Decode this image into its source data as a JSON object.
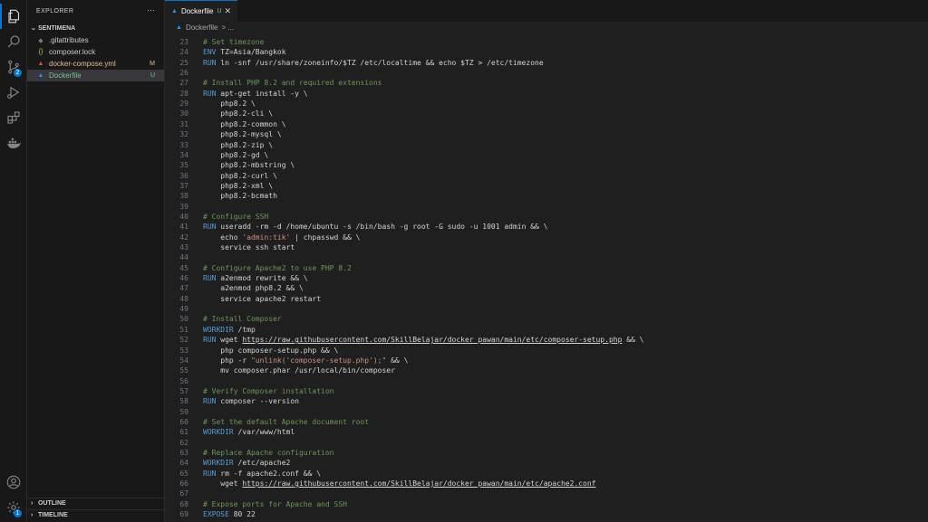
{
  "activity": {
    "items": [
      {
        "name": "explorer"
      },
      {
        "name": "search"
      },
      {
        "name": "source-control",
        "badge": "2"
      },
      {
        "name": "run-debug"
      },
      {
        "name": "extensions"
      },
      {
        "name": "docker"
      }
    ],
    "bottom": [
      {
        "name": "accounts"
      },
      {
        "name": "manage",
        "badge": "1"
      }
    ]
  },
  "sidebar": {
    "title": "EXPLORER",
    "more": "···",
    "folder": "SENTIMENA",
    "files": [
      {
        "icon": "◆",
        "icon_color": "#6d8086",
        "name": ".gitattributes",
        "status": "",
        "status_color": ""
      },
      {
        "icon": "{}",
        "icon_color": "#cbcb41",
        "name": "composer.lock",
        "status": "",
        "status_color": ""
      },
      {
        "icon": "▲",
        "icon_color": "#e44d26",
        "name": "docker-compose.yml",
        "status": "M",
        "status_color": "#e2c08d"
      },
      {
        "icon": "▲",
        "icon_color": "#2496ed",
        "name": "Dockerfile",
        "status": "U",
        "status_color": "#73c991"
      }
    ],
    "outline": "OUTLINE",
    "timeline": "TIMELINE"
  },
  "tab": {
    "label": "Dockerfile",
    "status": "U",
    "close": "✕"
  },
  "breadcrumb": {
    "file": "Dockerfile",
    "rest": "> ..."
  },
  "editor": {
    "lines": [
      {
        "n": "23",
        "t": "# Set timezone",
        "k": "cm"
      },
      {
        "n": "24",
        "k": "mix",
        "parts": [
          [
            "ENV",
            "kw"
          ],
          [
            " TZ=Asia/Bangkok",
            ""
          ]
        ]
      },
      {
        "n": "25",
        "k": "mix",
        "parts": [
          [
            "RUN",
            "kw"
          ],
          [
            " ln -snf /usr/share/zoneinfo/$TZ /etc/localtime && echo $TZ > /etc/timezone",
            ""
          ]
        ]
      },
      {
        "n": "26",
        "t": "",
        "k": ""
      },
      {
        "n": "27",
        "t": "# Install PHP 8.2 and required extensions",
        "k": "cm"
      },
      {
        "n": "28",
        "k": "mix",
        "parts": [
          [
            "RUN",
            "kw"
          ],
          [
            " apt-get install -y \\",
            ""
          ]
        ]
      },
      {
        "n": "29",
        "t": "    php8.2 \\",
        "k": ""
      },
      {
        "n": "30",
        "t": "    php8.2-cli \\",
        "k": ""
      },
      {
        "n": "31",
        "t": "    php8.2-common \\",
        "k": ""
      },
      {
        "n": "32",
        "t": "    php8.2-mysql \\",
        "k": ""
      },
      {
        "n": "33",
        "t": "    php8.2-zip \\",
        "k": ""
      },
      {
        "n": "34",
        "t": "    php8.2-gd \\",
        "k": ""
      },
      {
        "n": "35",
        "t": "    php8.2-mbstring \\",
        "k": ""
      },
      {
        "n": "36",
        "t": "    php8.2-curl \\",
        "k": ""
      },
      {
        "n": "37",
        "t": "    php8.2-xml \\",
        "k": ""
      },
      {
        "n": "38",
        "t": "    php8.2-bcmath",
        "k": ""
      },
      {
        "n": "39",
        "t": "",
        "k": ""
      },
      {
        "n": "40",
        "t": "# Configure SSH",
        "k": "cm"
      },
      {
        "n": "41",
        "k": "mix",
        "parts": [
          [
            "RUN",
            "kw"
          ],
          [
            " useradd -rm -d /home/ubuntu -s /bin/bash -g root -G sudo -u 1001 admin && \\",
            ""
          ]
        ]
      },
      {
        "n": "42",
        "k": "mix",
        "parts": [
          [
            "    echo ",
            ""
          ],
          [
            "'admin:tik'",
            "str"
          ],
          [
            " | chpasswd && \\",
            ""
          ]
        ]
      },
      {
        "n": "43",
        "t": "    service ssh start",
        "k": ""
      },
      {
        "n": "44",
        "t": "",
        "k": ""
      },
      {
        "n": "45",
        "t": "# Configure Apache2 to use PHP 8.2",
        "k": "cm"
      },
      {
        "n": "46",
        "k": "mix",
        "parts": [
          [
            "RUN",
            "kw"
          ],
          [
            " a2enmod rewrite && \\",
            ""
          ]
        ]
      },
      {
        "n": "47",
        "t": "    a2enmod php8.2 && \\",
        "k": ""
      },
      {
        "n": "48",
        "t": "    service apache2 restart",
        "k": ""
      },
      {
        "n": "49",
        "t": "",
        "k": ""
      },
      {
        "n": "50",
        "t": "# Install Composer",
        "k": "cm"
      },
      {
        "n": "51",
        "k": "mix",
        "parts": [
          [
            "WORKDIR",
            "kw"
          ],
          [
            " /tmp",
            ""
          ]
        ]
      },
      {
        "n": "52",
        "k": "mix",
        "parts": [
          [
            "RUN",
            "kw"
          ],
          [
            " wget ",
            ""
          ],
          [
            "https://raw.githubusercontent.com/SkillBelajar/docker_pawan/main/etc/composer-setup.php",
            "url"
          ],
          [
            " && \\",
            ""
          ]
        ]
      },
      {
        "n": "53",
        "t": "    php composer-setup.php && \\",
        "k": ""
      },
      {
        "n": "54",
        "k": "mix",
        "parts": [
          [
            "    php -r ",
            ""
          ],
          [
            "\"unlink('composer-setup.php');\"",
            "str"
          ],
          [
            " && \\",
            ""
          ]
        ]
      },
      {
        "n": "55",
        "t": "    mv composer.phar /usr/local/bin/composer",
        "k": ""
      },
      {
        "n": "56",
        "t": "",
        "k": ""
      },
      {
        "n": "57",
        "t": "# Verify Composer installation",
        "k": "cm"
      },
      {
        "n": "58",
        "k": "mix",
        "parts": [
          [
            "RUN",
            "kw"
          ],
          [
            " composer --version",
            ""
          ]
        ]
      },
      {
        "n": "59",
        "t": "",
        "k": ""
      },
      {
        "n": "60",
        "t": "# Set the default Apache document root",
        "k": "cm"
      },
      {
        "n": "61",
        "k": "mix",
        "parts": [
          [
            "WORKDIR",
            "kw"
          ],
          [
            " /var/www/html",
            ""
          ]
        ]
      },
      {
        "n": "62",
        "t": "",
        "k": ""
      },
      {
        "n": "63",
        "t": "# Replace Apache configuration",
        "k": "cm"
      },
      {
        "n": "64",
        "k": "mix",
        "parts": [
          [
            "WORKDIR",
            "kw"
          ],
          [
            " /etc/apache2",
            ""
          ]
        ]
      },
      {
        "n": "65",
        "k": "mix",
        "parts": [
          [
            "RUN",
            "kw"
          ],
          [
            " rm -f apache2.conf && \\",
            ""
          ]
        ]
      },
      {
        "n": "66",
        "k": "mix",
        "parts": [
          [
            "    wget ",
            ""
          ],
          [
            "https://raw.githubusercontent.com/SkillBelajar/docker_pawan/main/etc/apache2.conf",
            "url"
          ]
        ]
      },
      {
        "n": "67",
        "t": "",
        "k": ""
      },
      {
        "n": "68",
        "t": "# Expose ports for Apache and SSH",
        "k": "cm"
      },
      {
        "n": "69",
        "k": "mix",
        "parts": [
          [
            "EXPOSE",
            "kw"
          ],
          [
            " 80 22",
            ""
          ]
        ]
      }
    ]
  }
}
